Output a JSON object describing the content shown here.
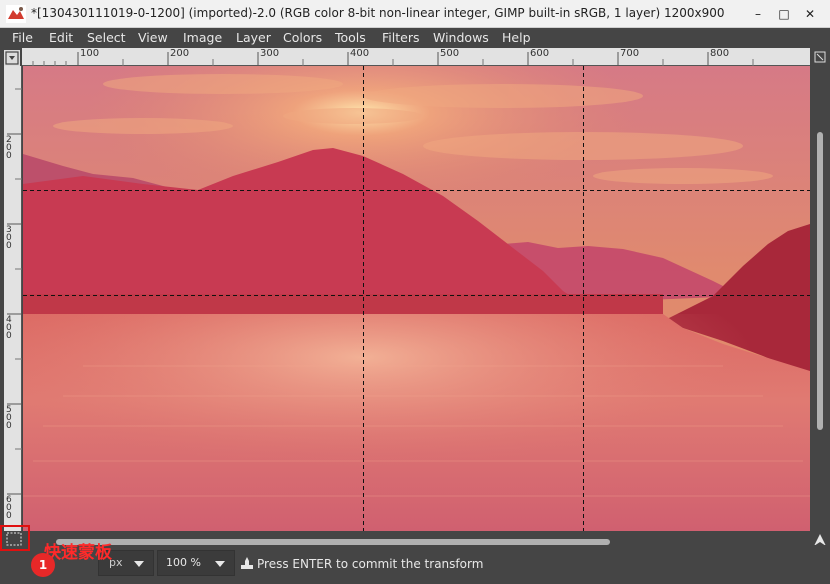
{
  "window": {
    "title": "*[130430111019-0-1200] (imported)-2.0 (RGB color 8-bit non-linear integer, GIMP built-in sRGB, 1 layer) 1200x900",
    "minimize": "–",
    "maximize": "□",
    "close": "✕"
  },
  "menu": [
    "File",
    "Edit",
    "Select",
    "View",
    "Image",
    "Layer",
    "Colors",
    "Tools",
    "Filters",
    "Windows",
    "Help"
  ],
  "rulers": {
    "top_labels": [
      "100",
      "200",
      "300",
      "400",
      "500",
      "600",
      "700",
      "800"
    ],
    "left_labels": [
      "200",
      "300",
      "400",
      "500",
      "600"
    ]
  },
  "status": {
    "unit": "px",
    "zoom": "100 %",
    "message": "Press ENTER to commit the transform"
  },
  "annotation": {
    "quick_mask_label": "快速蒙板",
    "badge": "1"
  },
  "colors": {
    "accent_red": "#e01010",
    "ui_dark": "#454545"
  }
}
